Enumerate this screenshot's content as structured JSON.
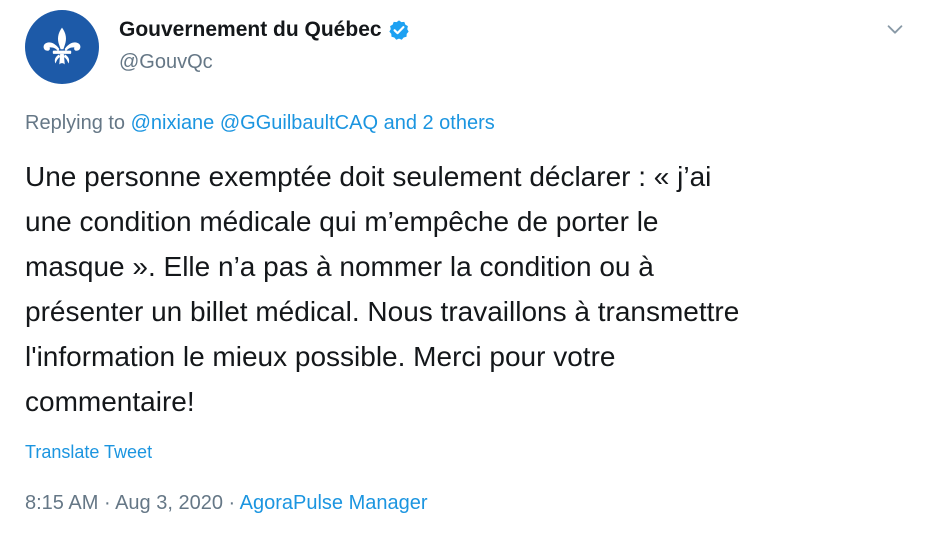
{
  "author": {
    "display_name": "Gouvernement du Québec",
    "handle": "@GouvQc",
    "verified": true,
    "avatar_icon": "fleur-de-lis-icon",
    "avatar_color": "#1d5aa8"
  },
  "replying": {
    "prefix": "Replying to",
    "mention_1": "@nixiane",
    "mention_2": "@GGuilbaultCAQ",
    "others": "and 2 others"
  },
  "tweet_lines": [
    "Une personne exemptée doit seulement déclarer : « j’ai",
    "une condition médicale qui m’empêche de porter le",
    "masque ». Elle n’a pas à nommer la condition ou à",
    "présenter un billet médical. Nous travaillons à transmettre",
    "l'information le mieux possible. Merci pour votre",
    "commentaire!"
  ],
  "translate_label": "Translate Tweet",
  "meta": {
    "time": "8:15 AM",
    "date": "Aug 3, 2020",
    "separator": "·",
    "source": "AgoraPulse Manager"
  },
  "colors": {
    "link": "#1b95e0",
    "secondary_text": "#657786",
    "primary_text": "#14171a"
  }
}
